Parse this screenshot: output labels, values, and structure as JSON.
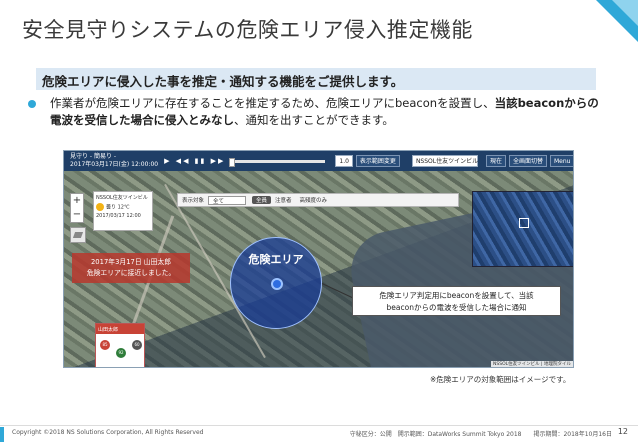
{
  "slide": {
    "title": "安全見守りシステムの危険エリア侵入推定機能",
    "banner": "危険エリアに侵入した事を推定・通知する機能をご提供します。",
    "bullet": {
      "part1": "作業者が危険エリアに存在することを推定するため、危険エリアにbeaconを設置し、",
      "bold1": "当該beaconからの電波を受信した場合に侵入とみなし",
      "part2": "、通知を出すことができます。"
    },
    "note": "※危険エリアの対象範囲はイメージです。",
    "page_number": "12"
  },
  "app": {
    "toolbar": {
      "title_line1": "見守り - 簡易り -",
      "title_line2": "2017年03月17日(金) 12:00:00",
      "playback_controls": "▶ ◀◀ ▮▮ ▶▶",
      "speed": "1.0",
      "btn_range": "表示範囲変更",
      "location_select": "NSSOL住友ツインビル",
      "btn_now": "現在",
      "btn_overview": "全画面切替",
      "btn_menu": "Menu"
    },
    "filters": {
      "label": "表示対象",
      "select_value": "全て",
      "opt_all": "全員",
      "opt_warning": "注意者",
      "opt_high": "高頻度のみ"
    },
    "weather": {
      "location": "NSSOL住友ツインビル",
      "condition": "曇り",
      "temp": "12℃",
      "updated": "2017/03/17 12:00"
    },
    "zoom_in": "+",
    "zoom_out": "−",
    "alert_note_line1": "2017年3月17日 山田太郎",
    "alert_note_line2": "危険エリアに接近しました。",
    "zone_label": "危険エリア",
    "callout_line1": "危険エリア判定用にbeaconを設置して、当該",
    "callout_line2": "beaconからの電波を受信した場合に通知",
    "person": {
      "name": "山田太郎",
      "badge1": "85",
      "badge2": "92",
      "badge3": "60"
    },
    "attribution": "NSSOL住友ツインビル | 地理院タイル"
  },
  "footer": {
    "copyright": "Copyright ©2018 NS Solutions Corporation, All Rights Reserved",
    "classification": "守秘区分：公開　開示範囲：DataWorks Summit Tokyo 2018　　掲示期間：2018年10月16日"
  },
  "colors": {
    "accent": "#2fa8d8",
    "banner_bg": "#dbe8f4",
    "toolbar_bg": "#1f3f67",
    "alert_red": "#c84336",
    "zone_blue": "#193c96"
  }
}
